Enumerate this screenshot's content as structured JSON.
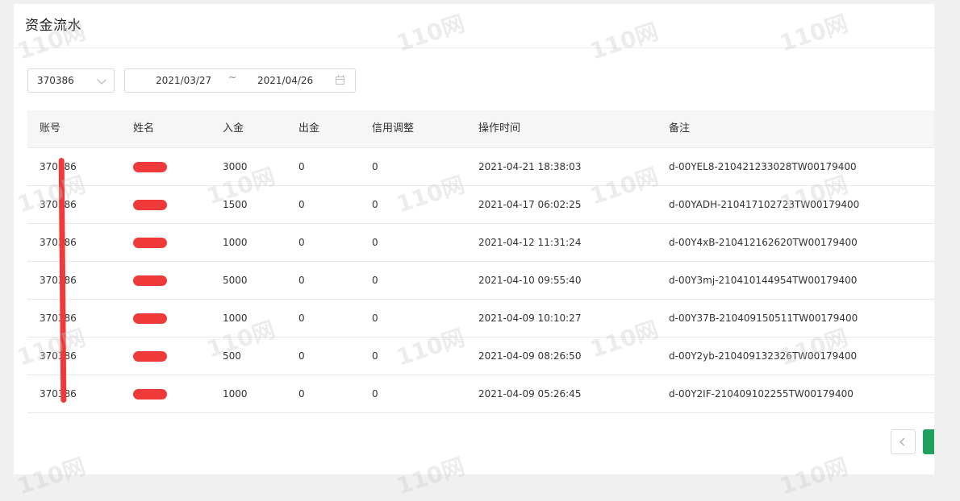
{
  "page_title": "资金流水",
  "filters": {
    "account_value": "370386",
    "date_start": "2021/03/27",
    "date_separator": "~",
    "date_end": "2021/04/26"
  },
  "table": {
    "headers": [
      "账号",
      "姓名",
      "入金",
      "出金",
      "信用调整",
      "操作时间",
      "备注"
    ],
    "rows": [
      {
        "account": "370386",
        "deposit": "3000",
        "withdraw": "0",
        "credit": "0",
        "time": "2021-04-21 18:38:03",
        "note": "d-00YEL8-210421233028TW00179400"
      },
      {
        "account": "370386",
        "deposit": "1500",
        "withdraw": "0",
        "credit": "0",
        "time": "2021-04-17 06:02:25",
        "note": "d-00YADH-210417102723TW00179400"
      },
      {
        "account": "370386",
        "deposit": "1000",
        "withdraw": "0",
        "credit": "0",
        "time": "2021-04-12 11:31:24",
        "note": "d-00Y4xB-210412162620TW00179400"
      },
      {
        "account": "370386",
        "deposit": "5000",
        "withdraw": "0",
        "credit": "0",
        "time": "2021-04-10 09:55:40",
        "note": "d-00Y3mj-210410144954TW00179400"
      },
      {
        "account": "370386",
        "deposit": "1000",
        "withdraw": "0",
        "credit": "0",
        "time": "2021-04-09 10:10:27",
        "note": "d-00Y37B-210409150511TW00179400"
      },
      {
        "account": "370386",
        "deposit": "500",
        "withdraw": "0",
        "credit": "0",
        "time": "2021-04-09 08:26:50",
        "note": "d-00Y2yb-210409132326TW00179400"
      },
      {
        "account": "370386",
        "deposit": "1000",
        "withdraw": "0",
        "credit": "0",
        "time": "2021-04-09 05:26:45",
        "note": "d-00Y2IF-210409102255TW00179400"
      }
    ]
  },
  "watermark": "110网",
  "icons": {
    "select_chevron": "chevron-down-icon",
    "calendar": "calendar-icon",
    "pager_prev": "chevron-left-icon"
  },
  "colors": {
    "redaction": "#f03a3a",
    "pager_active": "#1fa15b"
  }
}
